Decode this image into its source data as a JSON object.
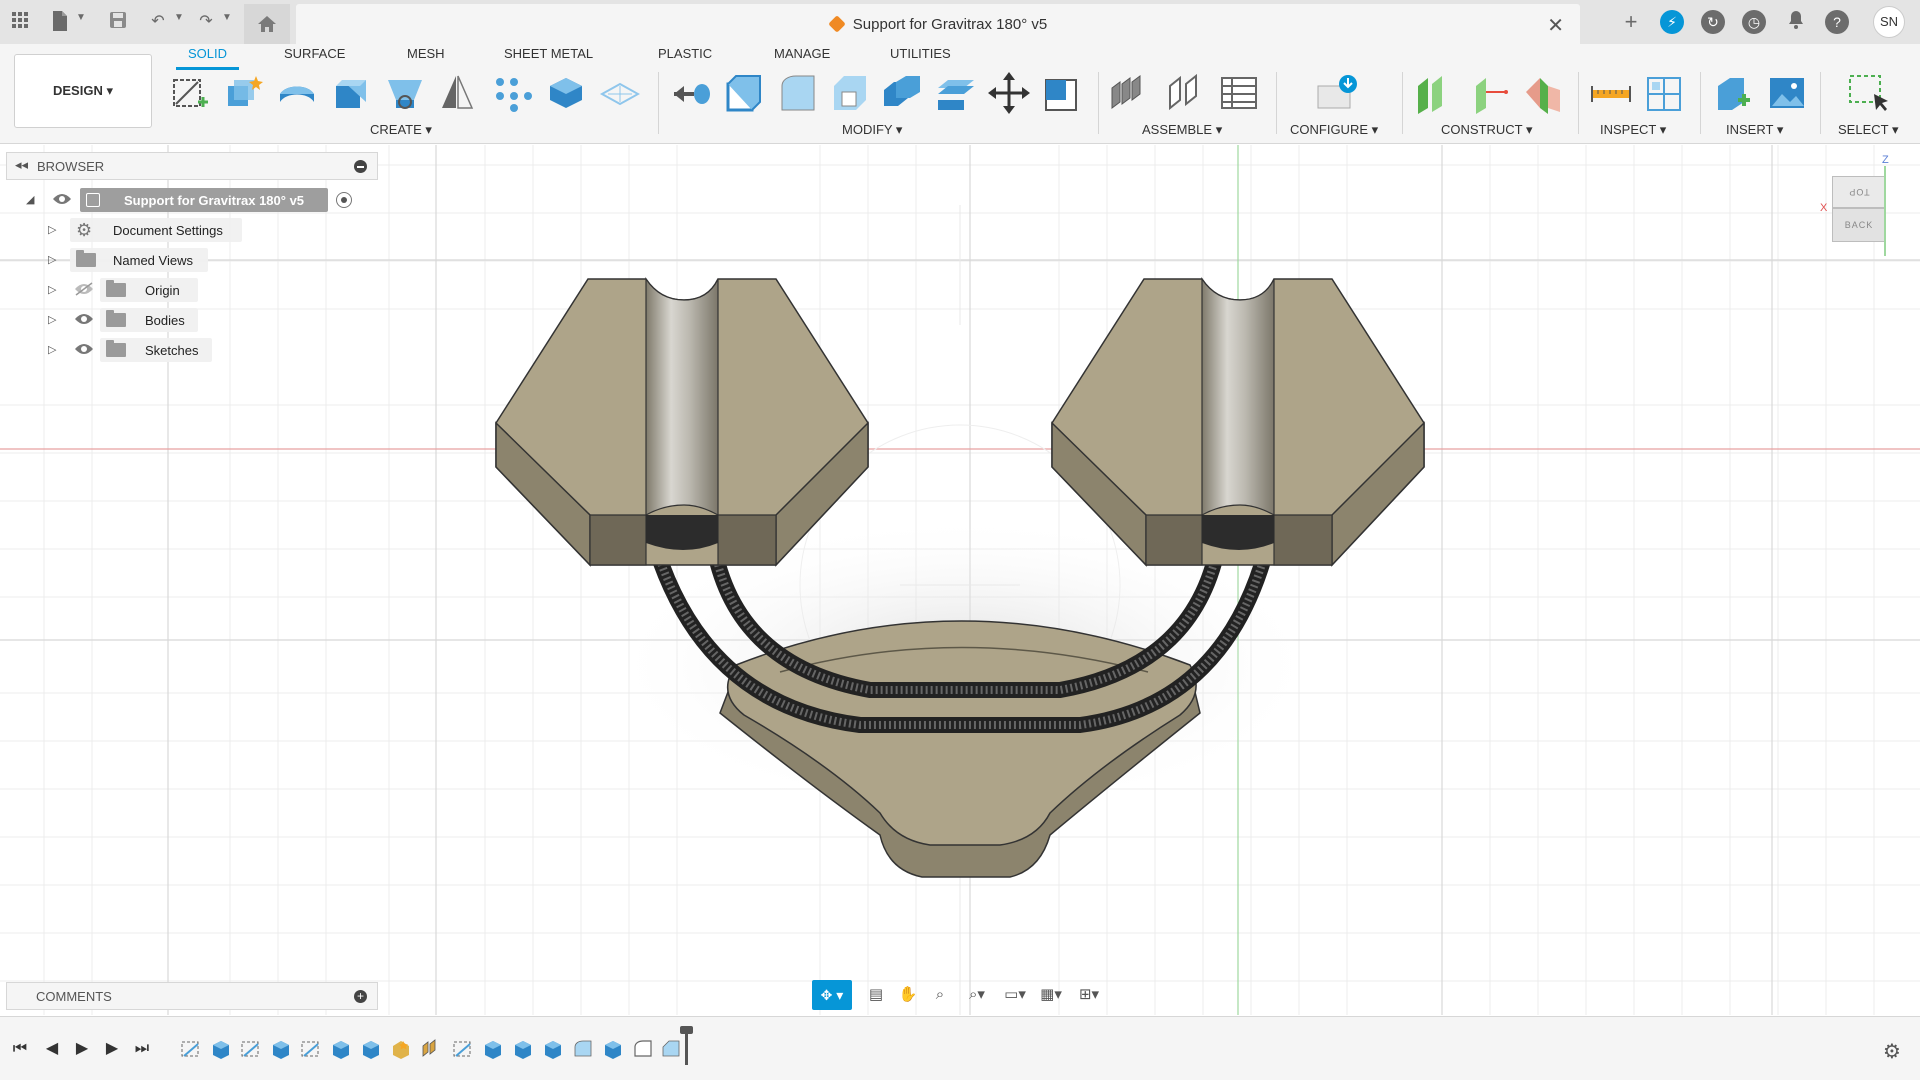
{
  "title_bar": {
    "document_title": "Support for Gravitrax 180° v5",
    "user_initials": "SN"
  },
  "ribbon": {
    "workspace_button": "DESIGN ▾",
    "tabs": [
      {
        "label": "SOLID",
        "active": true
      },
      {
        "label": "SURFACE",
        "active": false
      },
      {
        "label": "MESH",
        "active": false
      },
      {
        "label": "SHEET METAL",
        "active": false
      },
      {
        "label": "PLASTIC",
        "active": false
      },
      {
        "label": "MANAGE",
        "active": false
      },
      {
        "label": "UTILITIES",
        "active": false
      }
    ],
    "groups": {
      "create": "CREATE ▾",
      "modify": "MODIFY ▾",
      "assemble": "ASSEMBLE ▾",
      "configure": "CONFIGURE ▾",
      "construct": "CONSTRUCT ▾",
      "inspect": "INSPECT ▾",
      "insert": "INSERT ▾",
      "select": "SELECT ▾"
    }
  },
  "browser": {
    "title": "BROWSER",
    "root": "Support for Gravitrax 180° v5",
    "items": [
      {
        "label": "Document Settings",
        "icon": "gear-icon"
      },
      {
        "label": "Named Views",
        "icon": "folder-icon"
      },
      {
        "label": "Origin",
        "icon": "folder-icon",
        "visible": false
      },
      {
        "label": "Bodies",
        "icon": "folder-icon",
        "visible": true
      },
      {
        "label": "Sketches",
        "icon": "folder-icon",
        "visible": true
      }
    ]
  },
  "comments": {
    "title": "COMMENTS"
  },
  "viewcube": {
    "top": "TOP",
    "back": "BACK",
    "axis_z": "Z",
    "axis_x": "X"
  },
  "colors": {
    "accent": "#0696d7",
    "model_face": "#aea489",
    "model_side": "#8c846d",
    "model_dark": "#6f6857",
    "x_axis": "#e8a0a0",
    "y_axis": "#9fd89f"
  }
}
